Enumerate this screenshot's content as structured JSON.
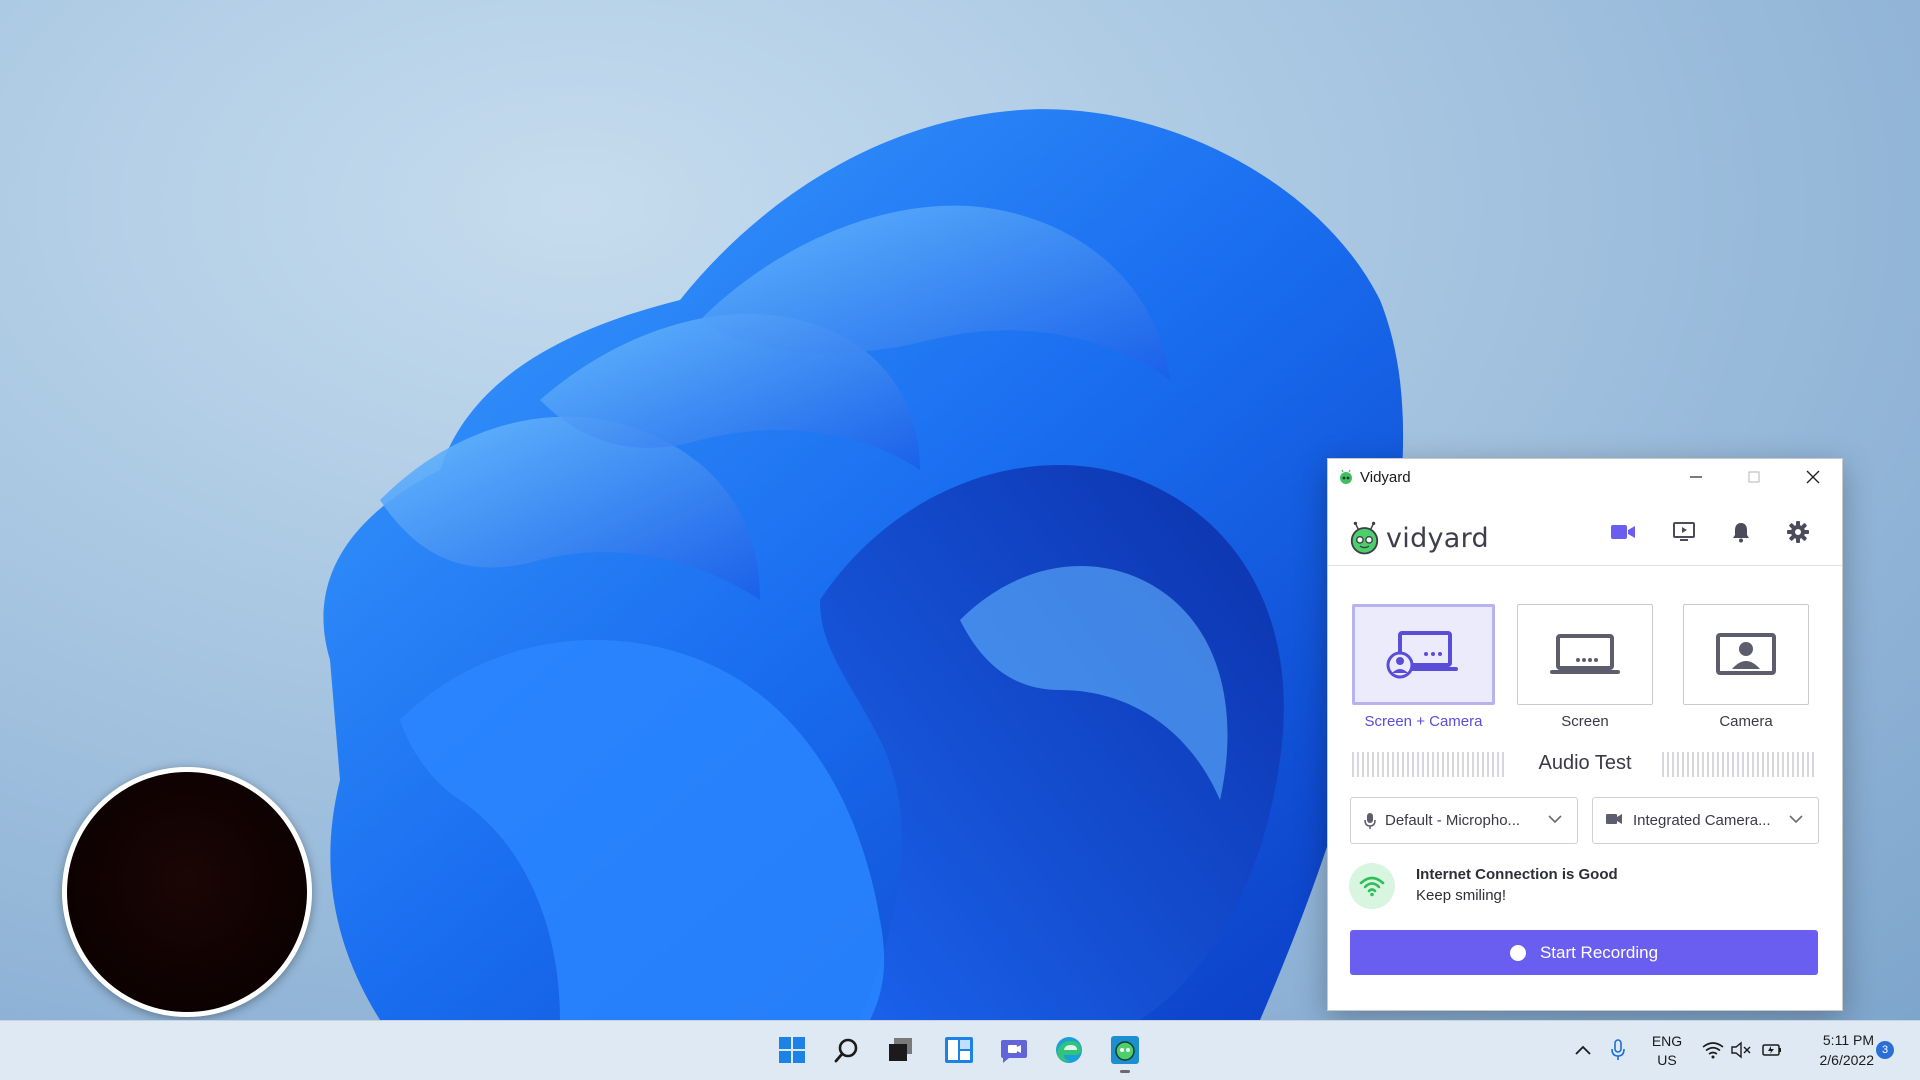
{
  "window": {
    "title": "Vidyard",
    "logo_text": "vidyard"
  },
  "modes": [
    {
      "label": "Screen + Camera",
      "selected": true
    },
    {
      "label": "Screen",
      "selected": false
    },
    {
      "label": "Camera",
      "selected": false
    }
  ],
  "audio_test": {
    "title": "Audio Test"
  },
  "microphone": {
    "value": "Default - Micropho..."
  },
  "camera": {
    "value": "Integrated Camera..."
  },
  "connection": {
    "title": "Internet Connection is Good",
    "subtitle": "Keep smiling!"
  },
  "record_button": {
    "label": "Start Recording"
  },
  "taskbar": {
    "language_line1": "ENG",
    "language_line2": "US",
    "time": "5:11 PM",
    "date": "2/6/2022",
    "notification_count": "3"
  },
  "colors": {
    "accent": "#6a5ef0",
    "selected_card": "#ecebfb",
    "connection_good": "#2fbf5a"
  },
  "icons": [
    "video-camera-icon",
    "screen-share-icon",
    "bell-icon",
    "gear-icon",
    "microphone-icon",
    "wifi-icon",
    "windows-start-icon",
    "search-icon",
    "task-view-icon",
    "widgets-icon",
    "chat-icon",
    "edge-icon",
    "vidyard-taskbar-icon"
  ]
}
